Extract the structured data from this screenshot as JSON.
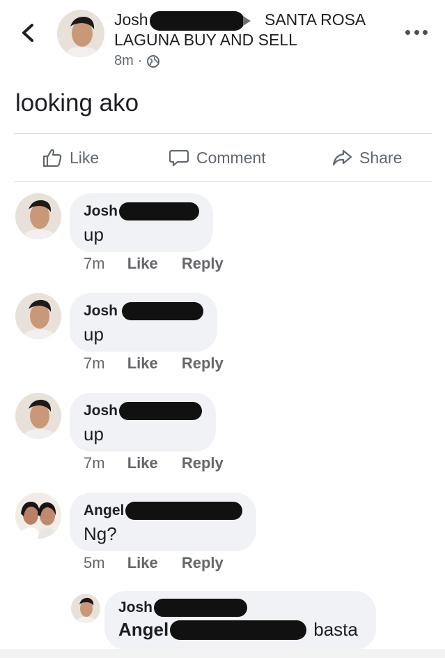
{
  "header": {
    "author": "Josh",
    "group_line1": "SANTA ROSA",
    "group_line2": "LAGUNA BUY AND SELL",
    "time": "8m",
    "dot": "·",
    "back_icon": "chevron-left-icon",
    "more_icon": "more-horizontal-icon",
    "privacy_icon": "globe-icon"
  },
  "post": {
    "text": "looking ako"
  },
  "actions": {
    "like": "Like",
    "comment": "Comment",
    "share": "Share"
  },
  "comments": [
    {
      "name": "Josh",
      "text": "up",
      "time": "7m",
      "like": "Like",
      "reply": "Reply"
    },
    {
      "name": "Josh",
      "text": "up",
      "time": "7m",
      "like": "Like",
      "reply": "Reply"
    },
    {
      "name": "Josh",
      "text": "up",
      "time": "7m",
      "like": "Like",
      "reply": "Reply"
    },
    {
      "name": "Angel",
      "text": "Ng?",
      "time": "5m",
      "like": "Like",
      "reply": "Reply"
    }
  ],
  "reply": {
    "name": "Josh",
    "mention": "Angel",
    "text": "basta"
  },
  "colors": {
    "text": "#1c1e21",
    "muted": "#65676b",
    "bubble": "#f0f2f5",
    "redaction": "#111111"
  }
}
